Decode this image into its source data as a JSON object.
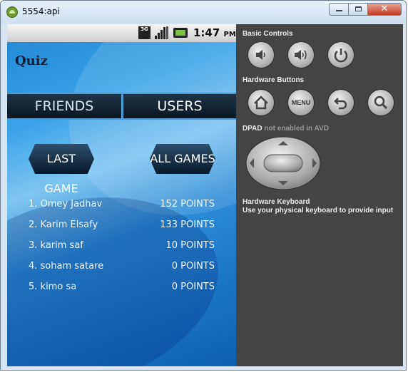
{
  "window": {
    "title": "5554:api"
  },
  "statusbar": {
    "network": "3G",
    "time": "1:47",
    "ampm": "PM"
  },
  "app": {
    "title": "Quiz"
  },
  "tabs": [
    {
      "label": "FRIENDS"
    },
    {
      "label": "USERS"
    }
  ],
  "buttons": {
    "last_game": "LAST GAME",
    "all_games": "ALL GAMES"
  },
  "leaderboard": [
    {
      "name": "1. Omey Jadhav",
      "points": "152 POINTS"
    },
    {
      "name": "2. Karim Elsafy",
      "points": "133 POINTS"
    },
    {
      "name": "3. karim saf",
      "points": "10 POINTS"
    },
    {
      "name": "4. soham satare",
      "points": "0 POINTS"
    },
    {
      "name": "5. kimo sa",
      "points": "0 POINTS"
    }
  ],
  "panel": {
    "basic_controls": "Basic Controls",
    "hardware_buttons": "Hardware Buttons",
    "menu_label": "MENU",
    "dpad_label": "DPAD",
    "dpad_note": "not enabled in AVD",
    "keyboard_title": "Hardware Keyboard",
    "keyboard_note": "Use your physical keyboard to provide input"
  }
}
